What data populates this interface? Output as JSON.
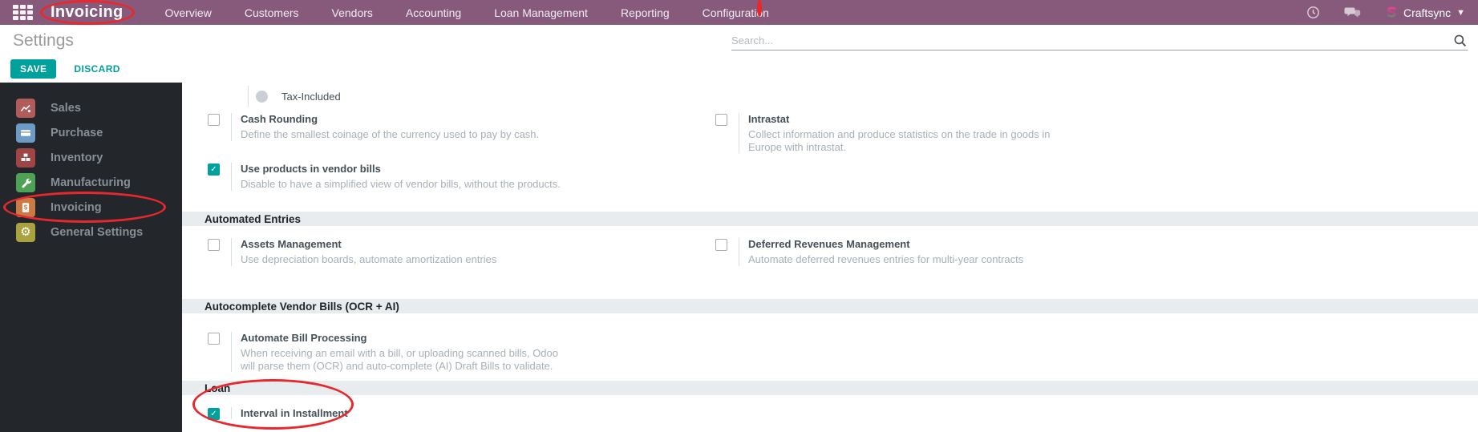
{
  "nav": {
    "brand": "Invoicing",
    "items": [
      "Overview",
      "Customers",
      "Vendors",
      "Accounting",
      "Loan Management",
      "Reporting",
      "Configuration"
    ],
    "user_name": "Craftsync"
  },
  "toolbar": {
    "title": "Settings",
    "save_label": "SAVE",
    "discard_label": "DISCARD",
    "search_placeholder": "Search..."
  },
  "sidebar": {
    "active_item": "Invoicing",
    "items": [
      {
        "label": "Sales",
        "icon": "sales-chart-icon",
        "color": "#b25b5b"
      },
      {
        "label": "Purchase",
        "icon": "purchase-card-icon",
        "color": "#6d9bc3"
      },
      {
        "label": "Inventory",
        "icon": "inventory-boxes-icon",
        "color": "#a04545"
      },
      {
        "label": "Manufacturing",
        "icon": "manufacturing-wrench-icon",
        "color": "#4da255"
      },
      {
        "label": "Invoicing",
        "icon": "invoicing-bill-icon",
        "color": "#ca7a44"
      },
      {
        "label": "General Settings",
        "icon": "general-settings-gear-icon",
        "color": "#aaa23e"
      }
    ]
  },
  "settings": {
    "tax_included": {
      "label": "Tax-Included",
      "selected": false
    },
    "cash_rounding": {
      "title": "Cash Rounding",
      "help": "Define the smallest coinage of the currency used to pay by cash.",
      "checked": false
    },
    "intrastat": {
      "title": "Intrastat",
      "help": "Collect information and produce statistics on the trade in goods in\nEurope with intrastat.",
      "checked": false
    },
    "use_products_in_vendor_bills": {
      "title": "Use products in vendor bills",
      "help": "Disable to have a simplified view of vendor bills, without the products.",
      "checked": true
    },
    "section_automated_entries": "Automated Entries",
    "assets_management": {
      "title": "Assets Management",
      "help": "Use depreciation boards, automate amortization entries",
      "checked": false
    },
    "deferred_revenues": {
      "title": "Deferred Revenues Management",
      "help": "Automate deferred revenues entries for multi-year contracts",
      "checked": false
    },
    "section_autocomplete": "Autocomplete Vendor Bills (OCR + AI)",
    "automate_bill_processing": {
      "title": "Automate Bill Processing",
      "help": "When receiving an email with a bill, or uploading scanned bills, Odoo\nwill parse them (OCR) and auto-complete (AI) Draft Bills to validate.",
      "checked": false
    },
    "section_loan": "Loan",
    "interval_in_installment": {
      "title": "Interval in Installment",
      "checked": true
    }
  },
  "annotations": {
    "shape": "ellipse",
    "color": "#e8282d",
    "highlighted": [
      "Invoicing (app brand)",
      "Configuration (menu item)",
      "Invoicing (sidebar item)",
      "Loan / Interval in Installment (setting)"
    ]
  },
  "colors": {
    "nav_background": "#875a7b",
    "accent_teal": "#00a09d",
    "sidebar_background": "#23272b",
    "section_band": "#e9ecef"
  }
}
